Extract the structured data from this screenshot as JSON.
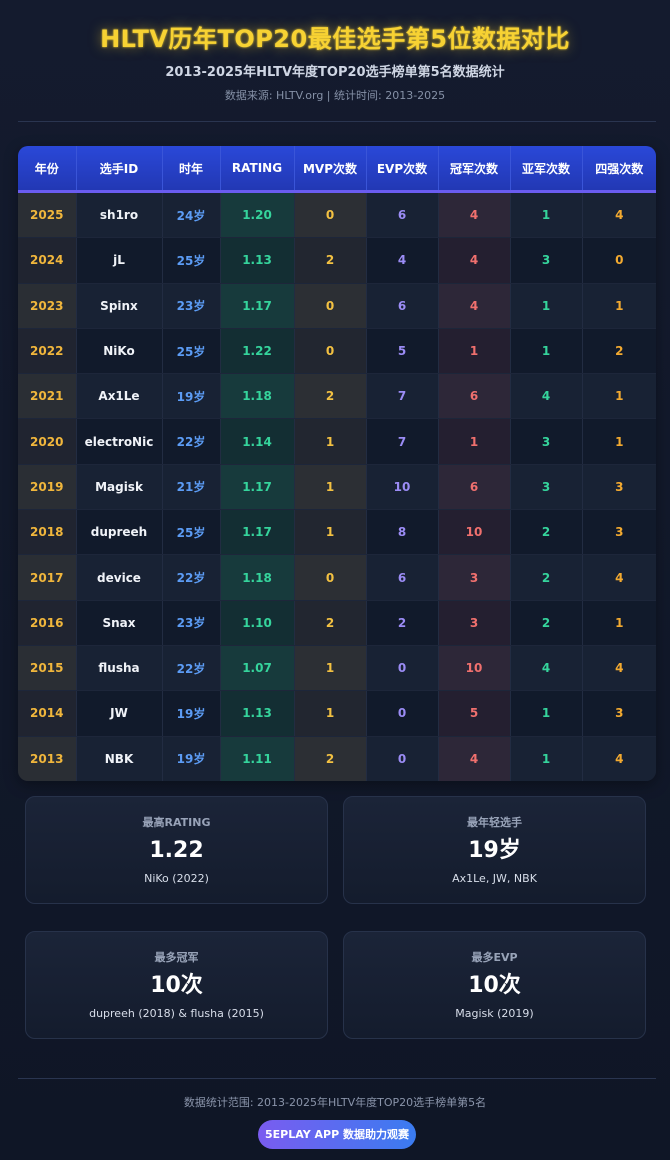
{
  "header": {
    "title": "HLTV历年TOP20最佳选手第5位数据对比",
    "subtitle": "2013-2025年HLTV年度TOP20选手榜单第5名数据统计",
    "source": "数据来源: HLTV.org | 统计时间: 2013-2025"
  },
  "table": {
    "columns": [
      "年份",
      "选手ID",
      "时年",
      "RATING",
      "MVP次数",
      "EVP次数",
      "冠军次数",
      "亚军次数",
      "四强次数"
    ],
    "rows": [
      [
        "2025",
        "sh1ro",
        "24岁",
        "1.20",
        "0",
        "6",
        "4",
        "1",
        "4"
      ],
      [
        "2024",
        "jL",
        "25岁",
        "1.13",
        "2",
        "4",
        "4",
        "3",
        "0"
      ],
      [
        "2023",
        "Spinx",
        "23岁",
        "1.17",
        "0",
        "6",
        "4",
        "1",
        "1"
      ],
      [
        "2022",
        "NiKo",
        "25岁",
        "1.22",
        "0",
        "5",
        "1",
        "1",
        "2"
      ],
      [
        "2021",
        "Ax1Le",
        "19岁",
        "1.18",
        "2",
        "7",
        "6",
        "4",
        "1"
      ],
      [
        "2020",
        "electroNic",
        "22岁",
        "1.14",
        "1",
        "7",
        "1",
        "3",
        "1"
      ],
      [
        "2019",
        "Magisk",
        "21岁",
        "1.17",
        "1",
        "10",
        "6",
        "3",
        "3"
      ],
      [
        "2018",
        "dupreeh",
        "25岁",
        "1.17",
        "1",
        "8",
        "10",
        "2",
        "3"
      ],
      [
        "2017",
        "device",
        "22岁",
        "1.18",
        "0",
        "6",
        "3",
        "2",
        "4"
      ],
      [
        "2016",
        "Snax",
        "23岁",
        "1.10",
        "2",
        "2",
        "3",
        "2",
        "1"
      ],
      [
        "2015",
        "flusha",
        "22岁",
        "1.07",
        "1",
        "0",
        "10",
        "4",
        "4"
      ],
      [
        "2014",
        "JW",
        "19岁",
        "1.13",
        "1",
        "0",
        "5",
        "1",
        "3"
      ],
      [
        "2013",
        "NBK",
        "19岁",
        "1.11",
        "2",
        "0",
        "4",
        "1",
        "4"
      ]
    ]
  },
  "cards": [
    {
      "label": "最高RATING",
      "value": "1.22",
      "note": "NiKo (2022)"
    },
    {
      "label": "最年轻选手",
      "value": "19岁",
      "note": "Ax1Le, JW, NBK"
    },
    {
      "label": "最多冠军",
      "value": "10次",
      "note": "dupreeh (2018) & flusha (2015)"
    },
    {
      "label": "最多EVP",
      "value": "10次",
      "note": "Magisk (2019)"
    }
  ],
  "footer": {
    "note": "数据统计范围: 2013-2025年HLTV年度TOP20选手榜单第5名",
    "badge": "5EPLAY APP 数据助力观赛"
  },
  "colors": {
    "title": "#f7d233",
    "header_bg": "#2a48d8",
    "year": "#f0b63c",
    "age": "#5c9cf5",
    "rating": "#35d49c",
    "mvp": "#f3c142",
    "evp": "#9b8cf5",
    "champion": "#f0706e",
    "runner_up": "#35d49c",
    "top4": "#f3aa30"
  }
}
